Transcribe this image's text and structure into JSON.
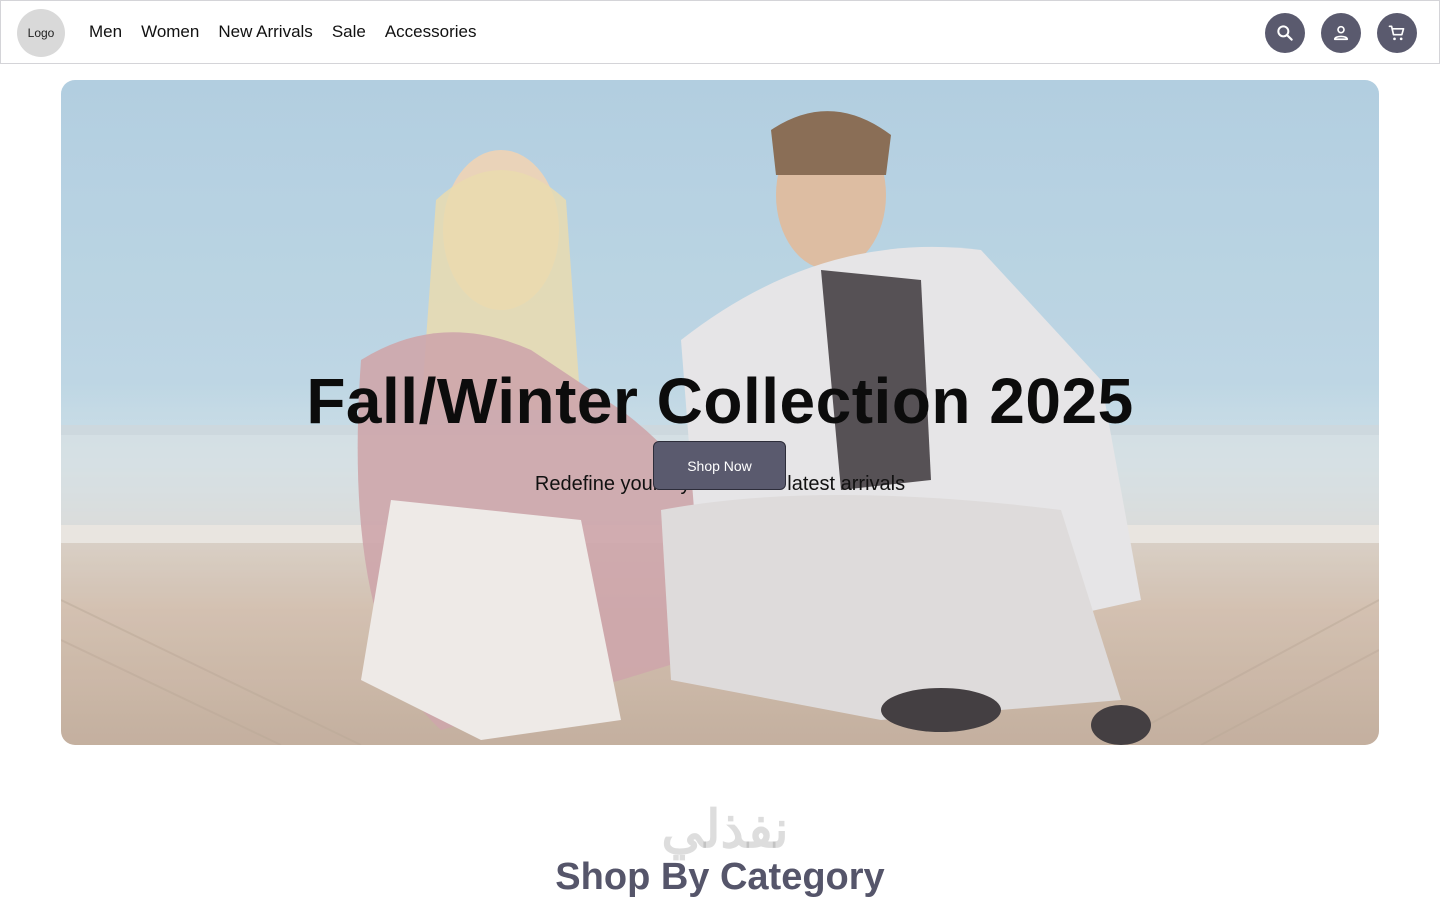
{
  "header": {
    "logo_text": "Logo",
    "nav": [
      "Men",
      "Women",
      "New Arrivals",
      "Sale",
      "Accessories"
    ],
    "icons": [
      "search-icon",
      "user-icon",
      "cart-icon"
    ],
    "icon_button_color": "#5a5a6e"
  },
  "hero": {
    "title": "Fall/Winter Collection 2025",
    "subtitle": "Redefine your style with our latest arrivals",
    "cta_label": "Shop Now",
    "image": "two-models-squatting-on-rooftop-photo"
  },
  "section": {
    "title": "Shop By Category"
  },
  "watermark": {
    "text": "نفذلي"
  }
}
